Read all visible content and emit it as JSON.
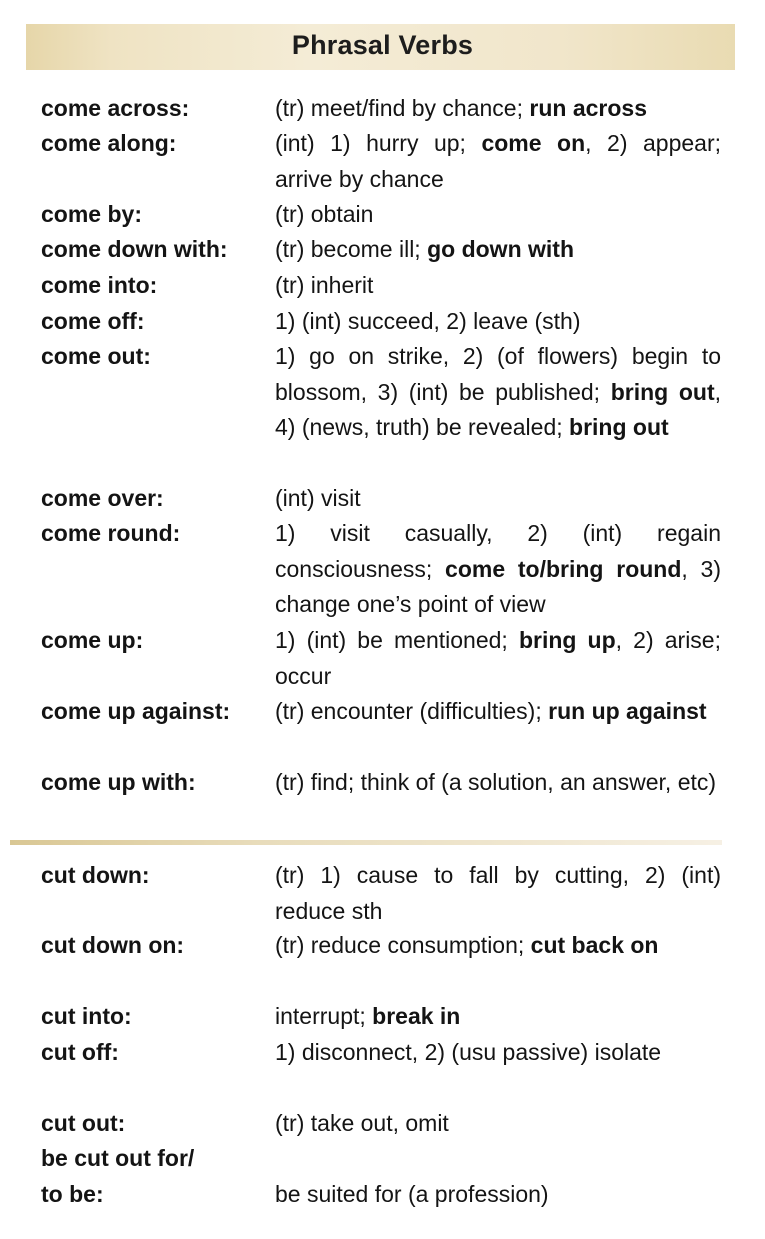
{
  "title": "Phrasal Verbs",
  "entries": [
    {
      "term": "come across:",
      "def": [
        {
          "t": "(tr) meet/find by chance; "
        },
        {
          "t": "run across",
          "b": true
        }
      ]
    },
    {
      "term": "come along:",
      "def": [
        {
          "t": "(int) 1) hurry up; "
        },
        {
          "t": "come on",
          "b": true
        },
        {
          "t": ", 2) appear; arrive by chance"
        }
      ]
    },
    {
      "term": "come by:",
      "def": [
        {
          "t": "(tr) obtain"
        }
      ]
    },
    {
      "term": "come down with:",
      "def": [
        {
          "t": "(tr) become ill; "
        },
        {
          "t": "go down with",
          "b": true
        }
      ]
    },
    {
      "term": "come into:",
      "def": [
        {
          "t": "(tr) inherit"
        }
      ]
    },
    {
      "term": "come off:",
      "def": [
        {
          "t": "1) (int) succeed, 2) leave (sth)"
        }
      ]
    },
    {
      "term": "come out:",
      "def": [
        {
          "t": "1) go on strike, 2) (of flowers) begin to blossom, 3) (int) be published; "
        },
        {
          "t": "bring out",
          "b": true
        },
        {
          "t": ", 4) (news, truth) be revealed; "
        },
        {
          "t": "bring out",
          "b": true
        }
      ]
    },
    {
      "term": "come over:",
      "def": [
        {
          "t": "(int) visit"
        }
      ]
    },
    {
      "term": "come round:",
      "def": [
        {
          "t": "1) visit casually, 2) (int) regain consciousness; "
        },
        {
          "t": "come to/bring round",
          "b": true
        },
        {
          "t": ", 3) change one’s point of view"
        }
      ]
    },
    {
      "term": "come up:",
      "def": [
        {
          "t": "1) (int) be mentioned; "
        },
        {
          "t": "bring up",
          "b": true
        },
        {
          "t": ", 2) arise; occur"
        }
      ]
    },
    {
      "term": "come up against:",
      "def": [
        {
          "t": "(tr) encounter (difficulties); "
        },
        {
          "t": "run up against",
          "b": true
        }
      ]
    },
    {
      "term": "come up with:",
      "def": [
        {
          "t": "(tr) find; think of (a solution, an answer, etc)"
        }
      ]
    },
    {
      "term": "cut down:",
      "def": [
        {
          "t": "(tr) 1) cause to fall by cutting, 2) (int) reduce sth"
        }
      ]
    },
    {
      "term": "cut down on:",
      "def": [
        {
          "t": "(tr) reduce consumption; "
        },
        {
          "t": "cut back on",
          "b": true
        }
      ]
    },
    {
      "term": "cut into:",
      "def": [
        {
          "t": "interrupt; "
        },
        {
          "t": "break in",
          "b": true
        }
      ]
    },
    {
      "term": "cut off:",
      "def": [
        {
          "t": "1) disconnect, 2) (usu passive) isolate"
        }
      ]
    },
    {
      "term": "cut out:",
      "def": [
        {
          "t": "(tr) take out, omit"
        }
      ]
    },
    {
      "term": "be cut out for/\nto be:",
      "def": [
        {
          "t": "be suited for (a profession)"
        }
      ]
    }
  ]
}
